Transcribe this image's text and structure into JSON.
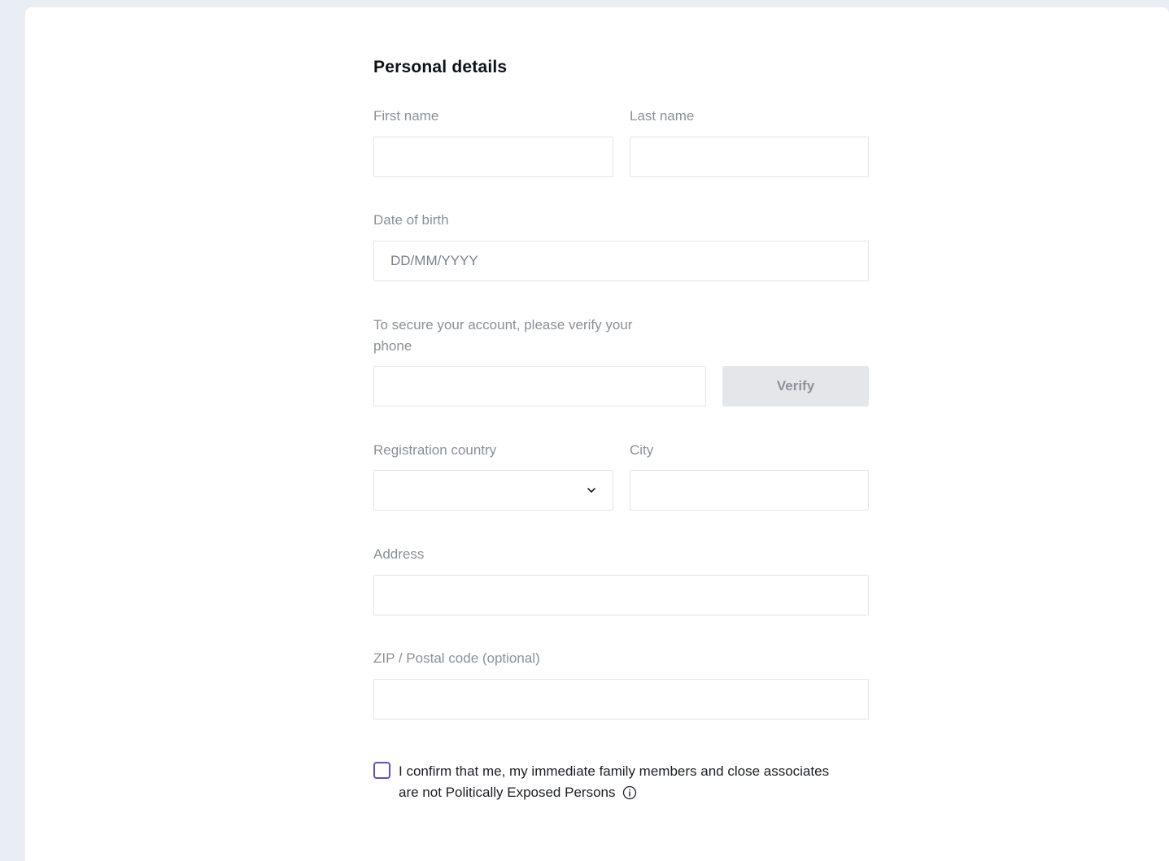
{
  "form": {
    "title": "Personal details",
    "first_name": {
      "label": "First name",
      "value": ""
    },
    "last_name": {
      "label": "Last name",
      "value": ""
    },
    "dob": {
      "label": "Date of birth",
      "placeholder": "DD/MM/YYYY",
      "value": ""
    },
    "phone": {
      "label_line1": "To secure your account, please verify your",
      "label_line2": "phone",
      "value": "",
      "verify_label": "Verify"
    },
    "country": {
      "label": "Registration country",
      "value": ""
    },
    "city": {
      "label": "City",
      "value": ""
    },
    "address": {
      "label": "Address",
      "value": ""
    },
    "zip": {
      "label": "ZIP / Postal code (optional)",
      "value": ""
    },
    "pep_confirm": {
      "text": "I confirm that me, my immediate family members and close associates are not Politically Exposed Persons",
      "checked": false
    }
  },
  "colors": {
    "page_bg": "#e9edf4",
    "card_bg": "#ffffff",
    "label": "#8b9096",
    "checkbox_border": "#5d4ecf",
    "button_bg": "#e4e6ea",
    "button_text": "#8e9298"
  },
  "icons": {
    "dropdown": "chevron-down-icon",
    "info": "info-icon"
  }
}
